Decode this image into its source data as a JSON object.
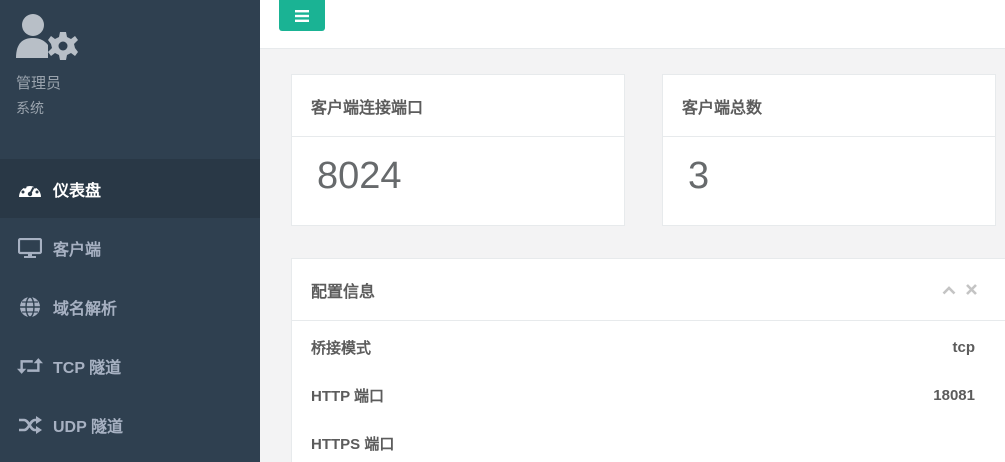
{
  "profile": {
    "name": "管理员",
    "role": "系统",
    "icon": "user-gear-icon"
  },
  "nav": [
    {
      "label": "仪表盘",
      "icon": "dashboard-icon",
      "active": true
    },
    {
      "label": "客户端",
      "icon": "desktop-icon",
      "active": false
    },
    {
      "label": "域名解析",
      "icon": "globe-icon",
      "active": false
    },
    {
      "label": "TCP 隧道",
      "icon": "retweet-icon",
      "active": false
    },
    {
      "label": "UDP 隧道",
      "icon": "random-icon",
      "active": false
    }
  ],
  "topbar": {
    "menu_icon": "bars-icon"
  },
  "stats": [
    {
      "title": "客户端连接端口",
      "value": "8024"
    },
    {
      "title": "客户端总数",
      "value": "3"
    }
  ],
  "config": {
    "title": "配置信息",
    "rows": [
      {
        "label": "桥接模式",
        "value": "tcp"
      },
      {
        "label": "HTTP 端口",
        "value": "18081"
      },
      {
        "label": "HTTPS 端口",
        "value": ""
      }
    ]
  },
  "colors": {
    "sidebar": "#2f4050",
    "sidebar_active": "#293846",
    "accent": "#1ab394"
  }
}
